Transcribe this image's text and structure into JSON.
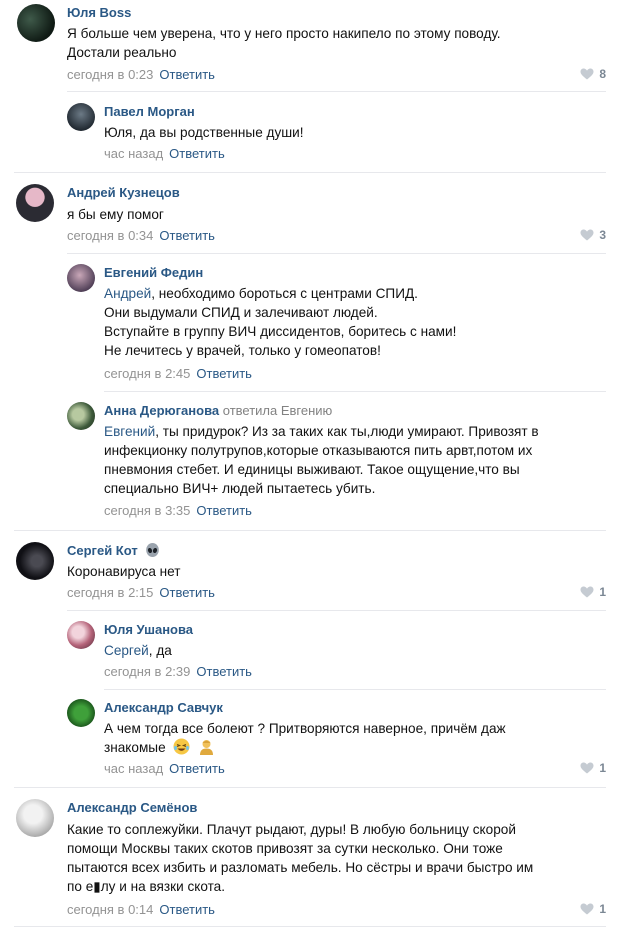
{
  "comments": [
    {
      "author": "Юля Boss",
      "lines": [
        "Я больше чем уверена, что у него просто накипело по этому поводу.",
        "Достали реально"
      ],
      "time": "сегодня в 0:23",
      "reply": "Ответить",
      "likes": "8"
    },
    {
      "author": "Павел Морган",
      "lines": [
        "Юля, да вы родственные души!"
      ],
      "time": "час назад",
      "reply": "Ответить"
    },
    {
      "author": "Андрей Кузнецов",
      "lines": [
        "я бы ему помог"
      ],
      "time": "сегодня в 0:34",
      "reply": "Ответить",
      "likes": "3"
    },
    {
      "author": "Евгений Федин",
      "mention": "Андрей",
      "lines": [
        ", необходимо бороться с центрами СПИД.",
        "Они выдумали СПИД и залечивают людей.",
        "Вступайте в группу ВИЧ диссидентов, боритесь с нами!",
        "Не лечитесь у врачей, только у гомеопатов!"
      ],
      "time": "сегодня в 2:45",
      "reply": "Ответить"
    },
    {
      "author": "Анна Дерюганова",
      "author_suffix": "ответила Евгению",
      "mention": "Евгений",
      "lines": [
        ", ты придурок? Из за таких как ты,люди умирают. Привозят в",
        "инфекционку полутрупов,которые отказываются пить арвт,потом их",
        "пневмония стебет. И единицы выживают. Такое ощущение,что вы",
        "специально ВИЧ+ людей пытаетесь убить."
      ],
      "time": "сегодня в 3:35",
      "reply": "Ответить"
    },
    {
      "author": "Сергей Кот",
      "author_emoji": "alien-emoji",
      "lines": [
        "Коронавируса нет"
      ],
      "time": "сегодня в 2:15",
      "reply": "Ответить",
      "likes": "1"
    },
    {
      "author": "Юля Ушанова",
      "mention": "Сергей",
      "lines": [
        ", да"
      ],
      "time": "сегодня в 2:39",
      "reply": "Ответить"
    },
    {
      "author": "Александр Савчук",
      "lines": [
        "А чем тогда все болеют ? Притворяются наверное, причём даж",
        "знакомые"
      ],
      "time": "час назад",
      "reply": "Ответить",
      "likes": "1"
    },
    {
      "author": "Александр Семёнов",
      "lines": [
        "Какие то соплежуйки. Плачут рыдают, дуры! В любую больницу скорой",
        "помощи Москвы таких скотов привозят за сутки несколько. Они тоже",
        "пытаются всех избить и разломать мебель. Но сёстры и врачи быстро им",
        "по е▮лу и на вязки скота."
      ],
      "time": "сегодня в 0:14",
      "reply": "Ответить",
      "likes": "1"
    }
  ],
  "colors": {
    "author": "#2a5885",
    "meta": "#939393",
    "divider": "#e7e8ec",
    "likes": "#7b8794"
  }
}
